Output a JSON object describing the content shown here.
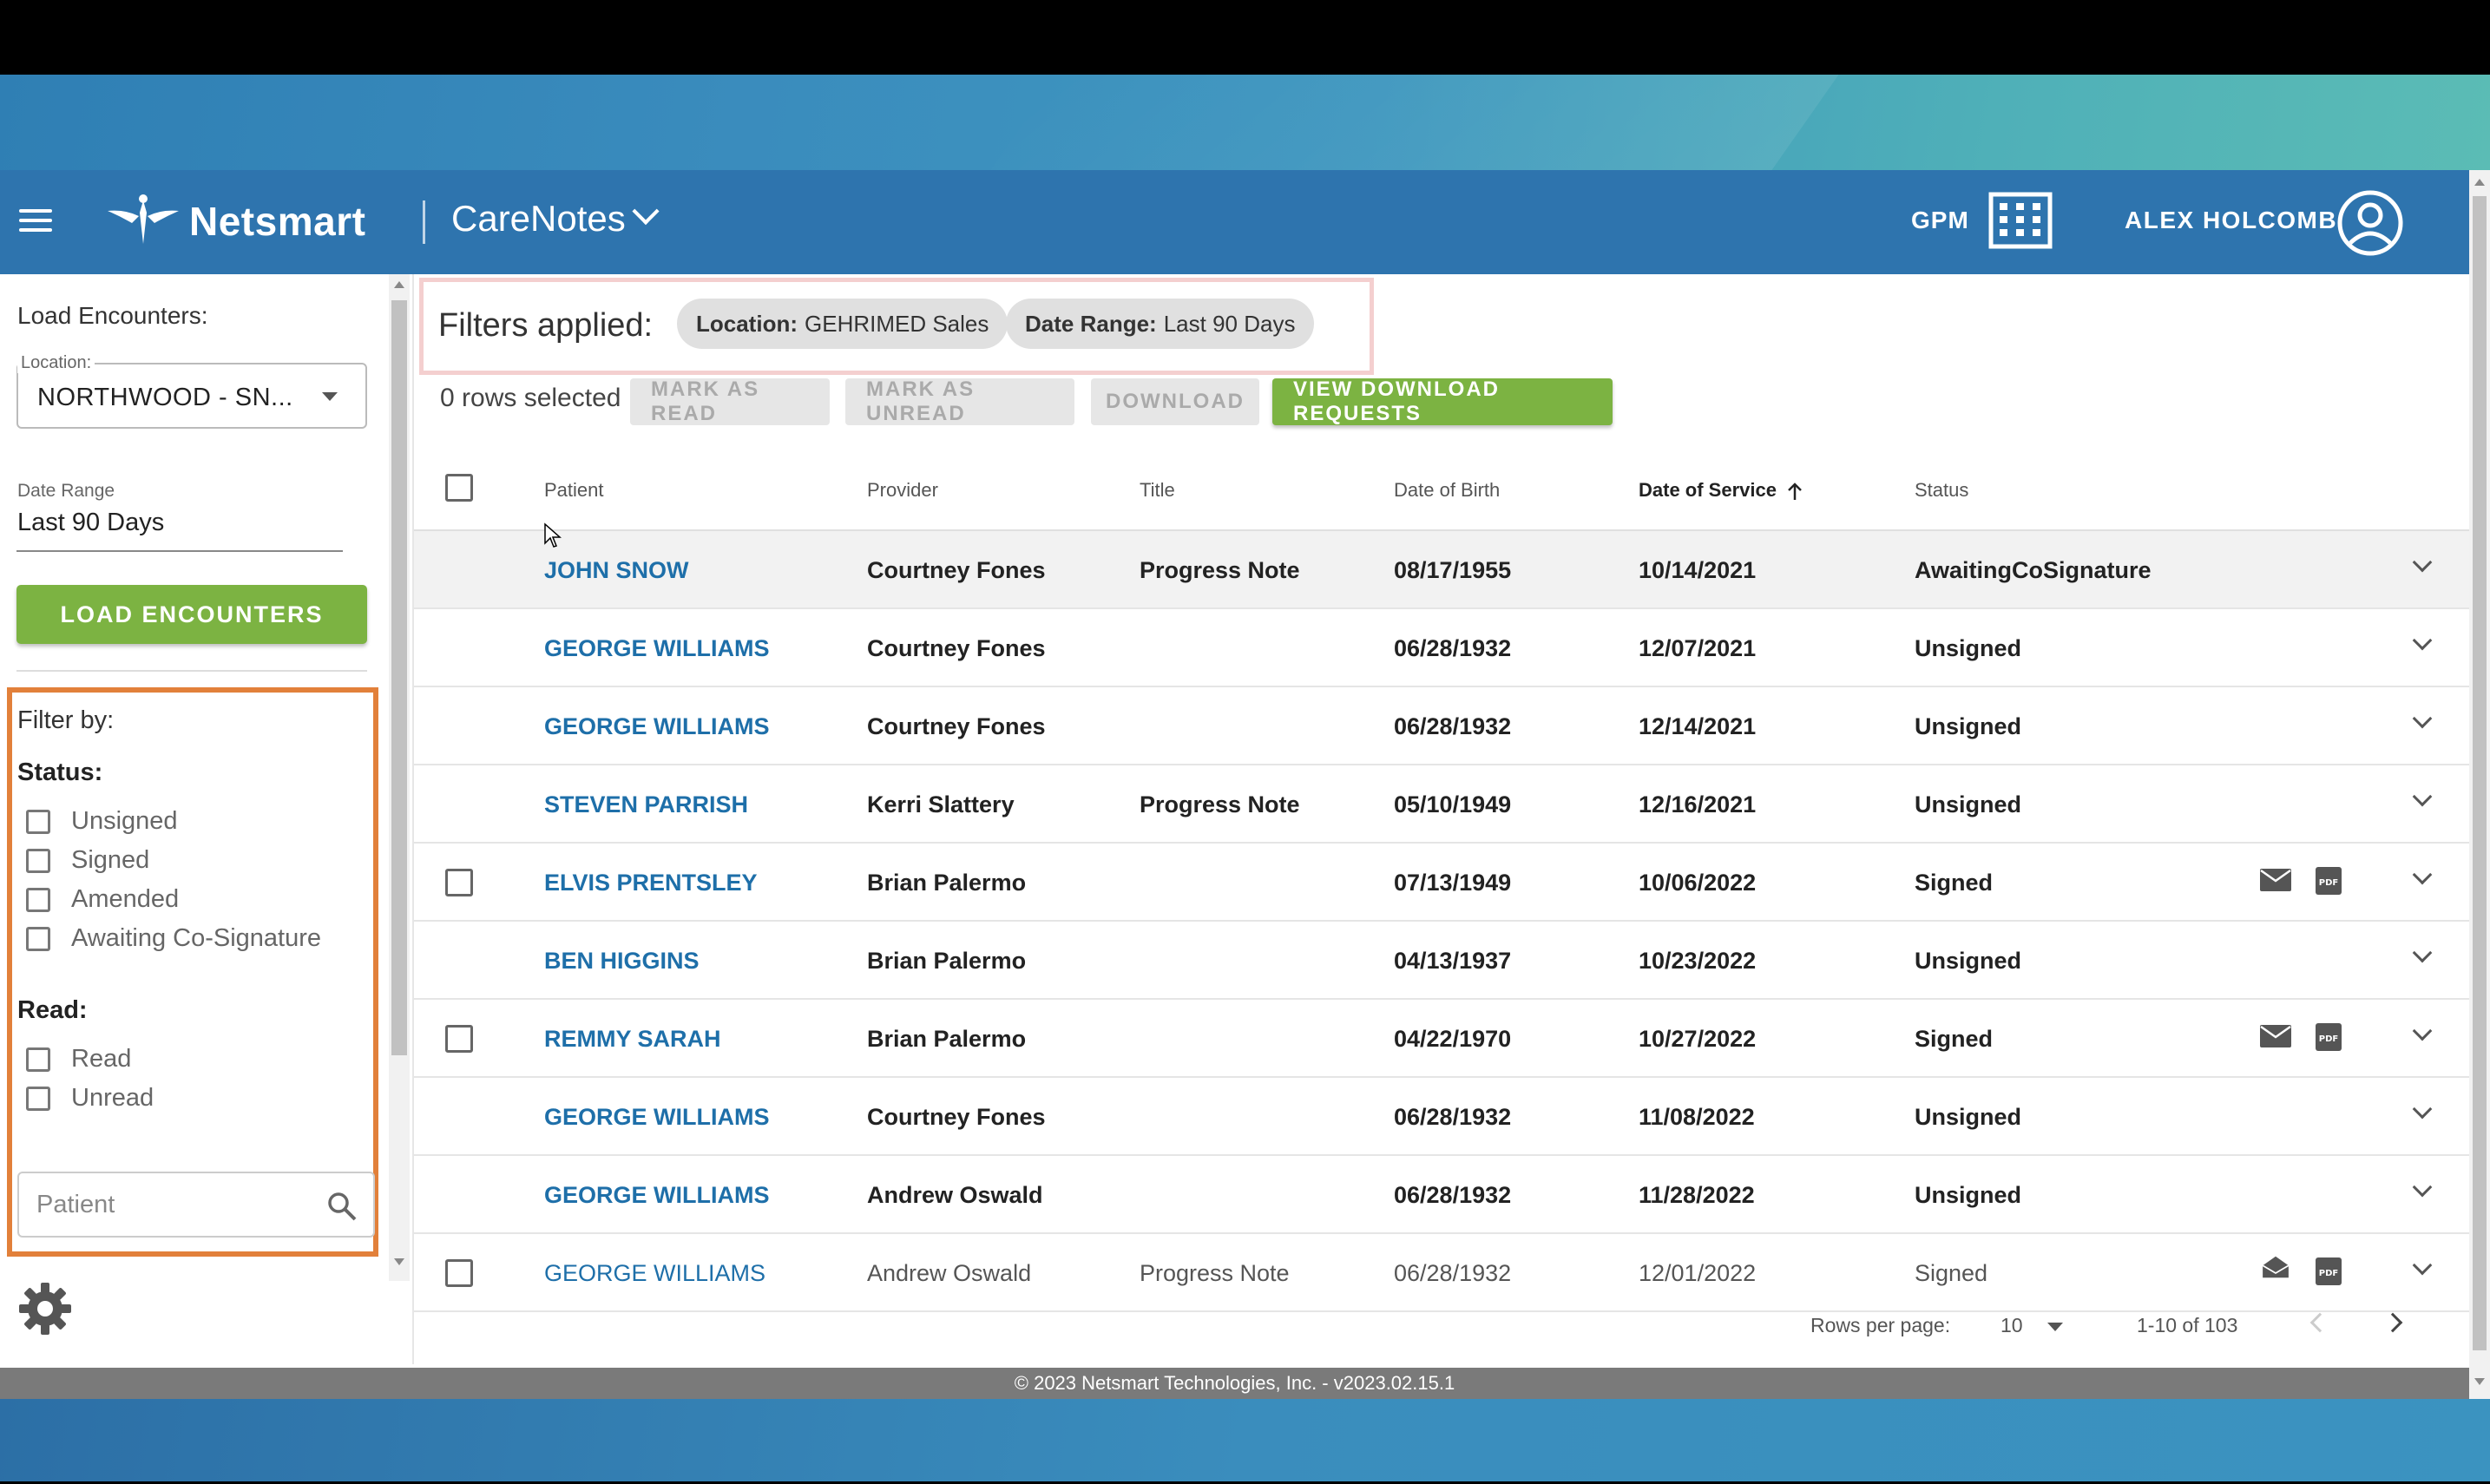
{
  "header": {
    "brand": "Netsmart",
    "product": "CareNotes",
    "org_code": "GPM",
    "user_name": "ALEX HOLCOMB"
  },
  "sidebar": {
    "load_encounters_label": "Load Encounters:",
    "location_legend": "Location:",
    "location_value": "NORTHWOOD - SN...",
    "date_range_label": "Date Range",
    "date_range_value": "Last 90 Days",
    "load_button": "LOAD ENCOUNTERS",
    "filter_by": "Filter by:",
    "status_header": "Status:",
    "status_options": [
      "Unsigned",
      "Signed",
      "Amended",
      "Awaiting Co-Signature"
    ],
    "read_header": "Read:",
    "read_options": [
      "Read",
      "Unread"
    ],
    "patient_placeholder": "Patient"
  },
  "filters_applied": {
    "label": "Filters applied:",
    "chips": [
      {
        "key": "Location:",
        "value": "GEHRIMED Sales"
      },
      {
        "key": "Date Range:",
        "value": "Last 90 Days"
      }
    ]
  },
  "toolbar": {
    "rows_selected": "0 rows selected",
    "mark_read": "MARK AS READ",
    "mark_unread": "MARK AS UNREAD",
    "download": "DOWNLOAD",
    "view_download_requests": "VIEW DOWNLOAD REQUESTS"
  },
  "table": {
    "columns": [
      "Patient",
      "Provider",
      "Title",
      "Date of Birth",
      "Date of Service",
      "Status"
    ],
    "rows": [
      {
        "patient": "JOHN SNOW",
        "provider": "Courtney Fones",
        "title": "Progress Note",
        "dob": "08/17/1955",
        "dos": "10/14/2021",
        "status": "AwaitingCoSignature",
        "checkbox": false,
        "actions": false
      },
      {
        "patient": "GEORGE WILLIAMS",
        "provider": "Courtney Fones",
        "title": "",
        "dob": "06/28/1932",
        "dos": "12/07/2021",
        "status": "Unsigned",
        "checkbox": false,
        "actions": false
      },
      {
        "patient": "GEORGE WILLIAMS",
        "provider": "Courtney Fones",
        "title": "",
        "dob": "06/28/1932",
        "dos": "12/14/2021",
        "status": "Unsigned",
        "checkbox": false,
        "actions": false
      },
      {
        "patient": "STEVEN PARRISH",
        "provider": "Kerri Slattery",
        "title": "Progress Note",
        "dob": "05/10/1949",
        "dos": "12/16/2021",
        "status": "Unsigned",
        "checkbox": false,
        "actions": false
      },
      {
        "patient": "ELVIS PRENTSLEY",
        "provider": "Brian Palermo",
        "title": "",
        "dob": "07/13/1949",
        "dos": "10/06/2022",
        "status": "Signed",
        "checkbox": true,
        "actions": true
      },
      {
        "patient": "BEN HIGGINS",
        "provider": "Brian Palermo",
        "title": "",
        "dob": "04/13/1937",
        "dos": "10/23/2022",
        "status": "Unsigned",
        "checkbox": false,
        "actions": false
      },
      {
        "patient": "REMMY SARAH",
        "provider": "Brian Palermo",
        "title": "",
        "dob": "04/22/1970",
        "dos": "10/27/2022",
        "status": "Signed",
        "checkbox": true,
        "actions": true
      },
      {
        "patient": "GEORGE WILLIAMS",
        "provider": "Courtney Fones",
        "title": "",
        "dob": "06/28/1932",
        "dos": "11/08/2022",
        "status": "Unsigned",
        "checkbox": false,
        "actions": false
      },
      {
        "patient": "GEORGE WILLIAMS",
        "provider": "Andrew Oswald",
        "title": "",
        "dob": "06/28/1932",
        "dos": "11/28/2022",
        "status": "Unsigned",
        "checkbox": false,
        "actions": false
      },
      {
        "patient": "GEORGE WILLIAMS",
        "provider": "Andrew Oswald",
        "title": "Progress Note",
        "dob": "06/28/1932",
        "dos": "12/01/2022",
        "status": "Signed",
        "checkbox": true,
        "actions": true,
        "read": true
      }
    ]
  },
  "pagination": {
    "rows_per_page_label": "Rows per page:",
    "rows_per_page_value": "10",
    "range": "1-10 of 103"
  },
  "footer": {
    "copyright": "© 2023 Netsmart Technologies, Inc. - v2023.02.15.1"
  },
  "colors": {
    "header_blue": "#2e74ae",
    "accent_green": "#7cb342",
    "link_blue": "#1e6fa9",
    "filter_highlight_orange": "#e2803a",
    "filters_applied_highlight": "#f4cfcf"
  },
  "icons": [
    "hamburger-icon",
    "netsmart-logo-icon",
    "chevron-down-icon",
    "building-icon",
    "user-account-icon",
    "search-icon",
    "gear-icon",
    "mail-icon",
    "mail-open-icon",
    "pdf-icon",
    "sort-ascending-icon",
    "chevron-left-icon",
    "chevron-right-icon"
  ]
}
